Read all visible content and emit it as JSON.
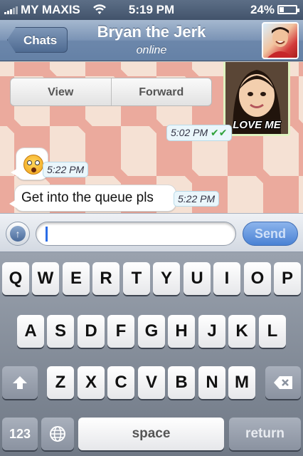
{
  "status_bar": {
    "carrier": "MY MAXIS",
    "time": "5:19 PM",
    "battery": "24%",
    "battery_level": 0.24
  },
  "nav": {
    "back_label": "Chats",
    "title": "Bryan the Jerk",
    "subtitle": "online"
  },
  "chat": {
    "menu": {
      "view_label": "View",
      "forward_label": "Forward"
    },
    "photo_message": {
      "caption": "LOVE ME",
      "time": "5:02 PM",
      "delivered": "✔✔"
    },
    "emoji_message": {
      "time": "5:22 PM"
    },
    "text_message": {
      "text": "Get into the queue pls",
      "time": "5:22 PM"
    }
  },
  "input": {
    "value": "",
    "placeholder": "",
    "send_label": "Send"
  },
  "keyboard": {
    "row1": [
      "Q",
      "W",
      "E",
      "R",
      "T",
      "Y",
      "U",
      "I",
      "O",
      "P"
    ],
    "row2": [
      "A",
      "S",
      "D",
      "F",
      "G",
      "H",
      "J",
      "K",
      "L"
    ],
    "row3": [
      "Z",
      "X",
      "C",
      "V",
      "B",
      "N",
      "M"
    ],
    "numbers_label": "123",
    "space_label": "space",
    "return_label": "return"
  }
}
